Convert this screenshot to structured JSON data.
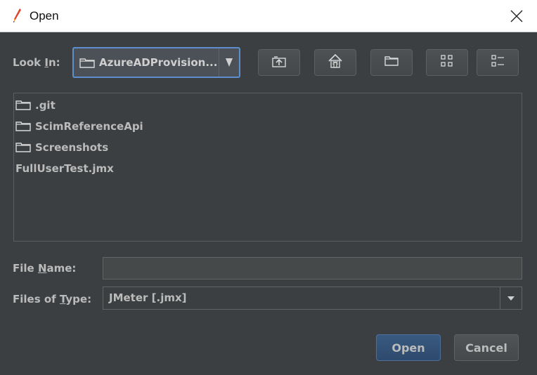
{
  "window": {
    "title": "Open"
  },
  "look_in": {
    "label_pre": "Look ",
    "label_mnemonic": "I",
    "label_post": "n:",
    "value": "AzureADProvision..."
  },
  "files": [
    {
      "name": ".git",
      "type": "folder"
    },
    {
      "name": "ScimReferenceApi",
      "type": "folder"
    },
    {
      "name": "Screenshots",
      "type": "folder"
    },
    {
      "name": "FullUserTest.jmx",
      "type": "file"
    }
  ],
  "file_name": {
    "label_pre": "File ",
    "label_mnemonic": "N",
    "label_post": "ame:",
    "value": ""
  },
  "files_of_type": {
    "label_pre": "Files of ",
    "label_mnemonic": "T",
    "label_post": "ype:",
    "value": "JMeter [.jmx]"
  },
  "buttons": {
    "open": "Open",
    "cancel": "Cancel"
  },
  "colors": {
    "background": "#3c3f41",
    "accent": "#5f8ecf",
    "text": "#bbbbbb",
    "primary_button": "#395a80"
  }
}
